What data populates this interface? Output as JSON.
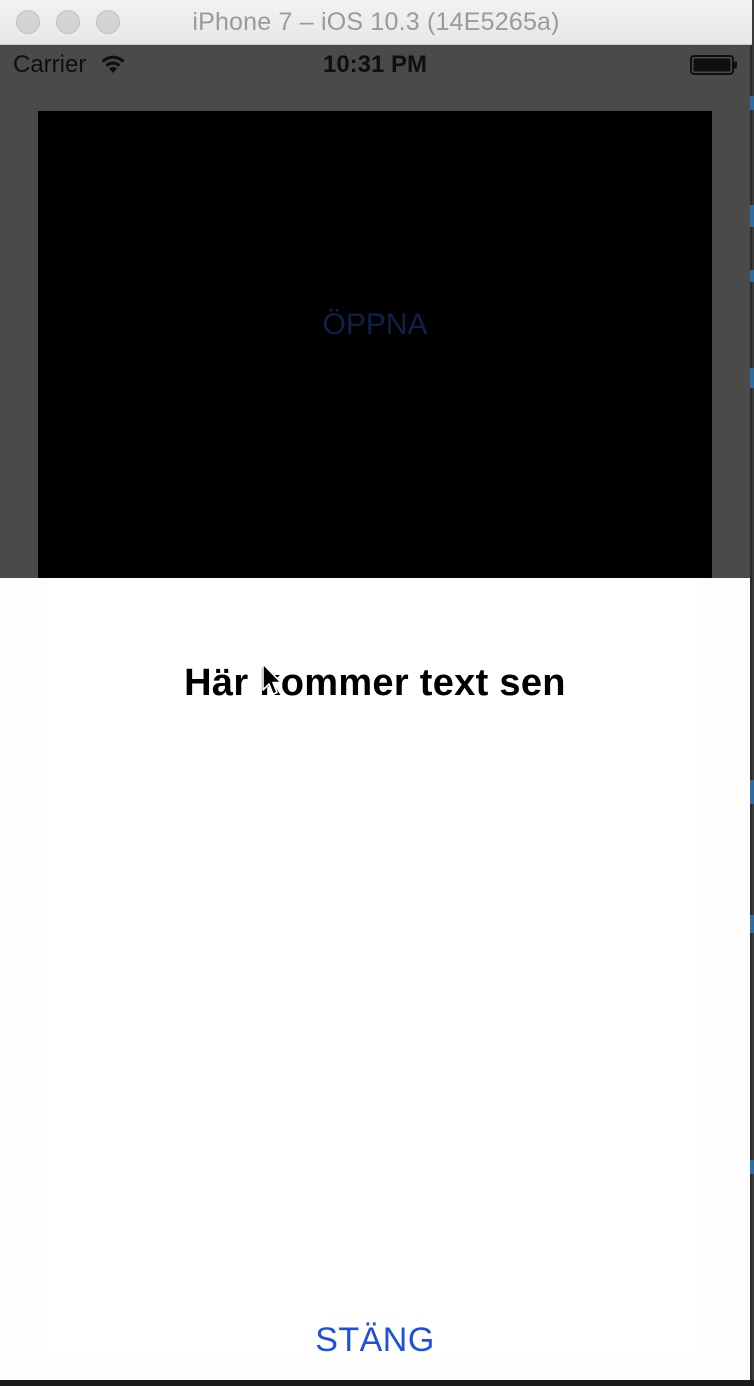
{
  "window": {
    "title": "iPhone 7 – iOS 10.3 (14E5265a)"
  },
  "statusbar": {
    "carrier": "Carrier",
    "time": "10:31 PM",
    "wifi_icon": "wifi-icon",
    "battery_icon": "battery-icon"
  },
  "main": {
    "open_label": "ÖPPNA"
  },
  "sheet": {
    "text": "Här kommer text sen",
    "close_label": "STÄNG"
  },
  "colors": {
    "accent": "#1e4fe0",
    "dimmed_overlay": "#4a4a4a",
    "dark_view": "#000000",
    "sheet_background": "#ffffff"
  }
}
